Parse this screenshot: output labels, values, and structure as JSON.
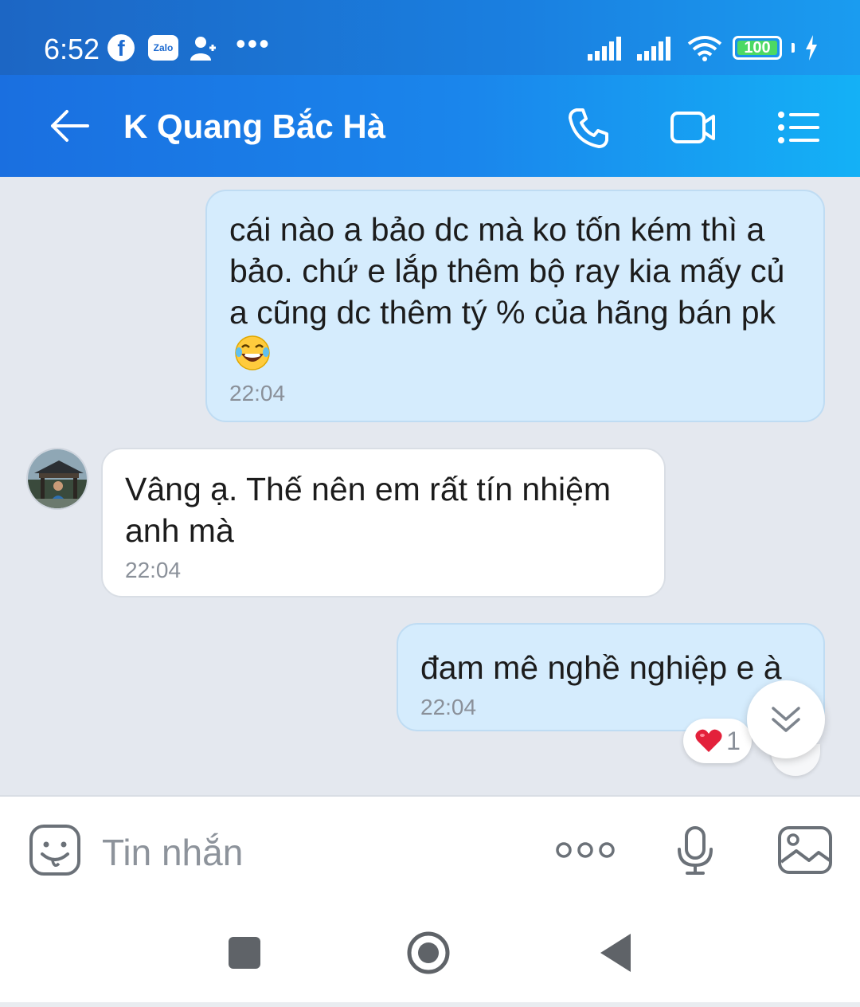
{
  "status_bar": {
    "time": "6:52",
    "battery": "100",
    "icons": [
      "facebook-icon",
      "zalo-icon",
      "person-add-icon",
      "more-dots-icon",
      "signal-icon",
      "signal-icon",
      "wifi-icon",
      "battery-icon",
      "charging-icon"
    ],
    "zalo_label": "Zalo",
    "dots": "•••"
  },
  "header": {
    "title": "K Quang Bắc Hà",
    "icons": [
      "back-arrow-icon",
      "phone-icon",
      "video-camera-icon",
      "menu-list-icon"
    ]
  },
  "messages": [
    {
      "direction": "outgoing",
      "text": "cái nào a bảo dc mà ko tốn kém thì a bảo. chứ e lắp thêm bộ ray kia mấy củ a cũng dc thêm tý % của hãng bán pk",
      "emoji": "laughing-tears-emoji",
      "time": "22:04"
    },
    {
      "direction": "incoming",
      "text": "Vâng ạ. Thế nên em rất tín nhiệm anh mà",
      "time": "22:04"
    },
    {
      "direction": "outgoing",
      "text": "đam mê nghề nghiệp e à",
      "time": "22:04",
      "reaction": {
        "icon": "heart-icon",
        "count": "1"
      }
    }
  ],
  "composer": {
    "placeholder": "Tin nhắn",
    "icons": [
      "sticker-icon",
      "more-options-icon",
      "microphone-icon",
      "image-icon"
    ]
  },
  "colors": {
    "header_start": "#1a6fe0",
    "header_end": "#14b1f6",
    "outgoing_bubble": "#d5ecfd",
    "incoming_bubble": "#ffffff",
    "chat_background": "#e4e8ef",
    "battery_green": "#4cd964"
  }
}
